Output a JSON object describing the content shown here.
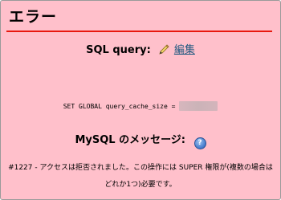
{
  "dialog": {
    "title": "エラー",
    "accent_color": "#e8190f",
    "background_color": "#ffc0cb"
  },
  "sql_section": {
    "heading": "SQL query:",
    "edit_icon": "pencil-icon",
    "edit_label": "編集",
    "query_text": "SET GLOBAL query_cache_size ="
  },
  "message_section": {
    "heading": "MySQL のメッセージ:",
    "help_icon": "help-icon",
    "help_glyph": "?",
    "error_text": "#1227 - アクセスは拒否されました。この操作には SUPER 権限が(複数の場合はどれか1つ)必要です。"
  }
}
